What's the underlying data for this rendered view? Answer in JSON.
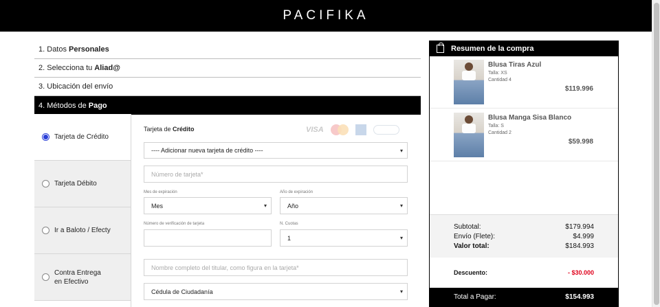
{
  "brand": {
    "logo": "PACIFIKA"
  },
  "steps": [
    {
      "num": "1.",
      "pre": "Datos",
      "bold": "Personales"
    },
    {
      "num": "2.",
      "pre": "Selecciona tu",
      "bold": "Aliad@"
    },
    {
      "num": "3.",
      "pre": "Ubicación del envío",
      "bold": ""
    },
    {
      "num": "4.",
      "pre": "Métodos de",
      "bold": "Pago"
    }
  ],
  "payment_methods": [
    {
      "label": "Tarjeta de Crédito",
      "selected": true
    },
    {
      "label": "Tarjeta Débito",
      "selected": false
    },
    {
      "label": "Ir a Baloto / Efecty",
      "selected": false
    },
    {
      "label": "Contra Entrega en Efectivo",
      "selected": false
    }
  ],
  "form": {
    "title_pre": "Tarjeta de",
    "title_bold": "Crédito",
    "card_brands": {
      "visa": "VISA"
    },
    "card_select": "---- Adicionar nueva tarjeta de crédito ----",
    "card_number_placeholder": "Número de tarjeta*",
    "exp_month_label": "Mes de expiración",
    "exp_month_value": "Mes",
    "exp_year_label": "Año de expiración",
    "exp_year_value": "Año",
    "cvv_label": "Número de verificación de tarjeta",
    "cvv_value": "",
    "installments_label": "N. Cuotas",
    "installments_value": "1",
    "holder_placeholder": "Nombre completo del titular, como figura en la tarjeta*",
    "doc_type_value": "Cédula de Ciudadanía"
  },
  "summary": {
    "title": "Resumen de la compra",
    "items": [
      {
        "name": "Blusa Tiras Azul",
        "size": "Talla: XS",
        "qty": "Cantidad 4",
        "price": "$119.996"
      },
      {
        "name": "Blusa Manga Sisa Blanco",
        "size": "Talla: S",
        "qty": "Cantidad 2",
        "price": "$59.998"
      }
    ],
    "subtotal_label": "Subtotal:",
    "subtotal": "$179.994",
    "shipping_label": "Envío (Flete):",
    "shipping": "$4.999",
    "total_value_label": "Valor total:",
    "total_value": "$184.993",
    "discount_label": "Descuento:",
    "discount": "- $30.000",
    "to_pay_label": "Total a Pagar:",
    "to_pay": "$154.993"
  },
  "colors": {
    "header": "#000000",
    "radio_selected": "#2a3fd8",
    "discount": "#e0001b"
  }
}
